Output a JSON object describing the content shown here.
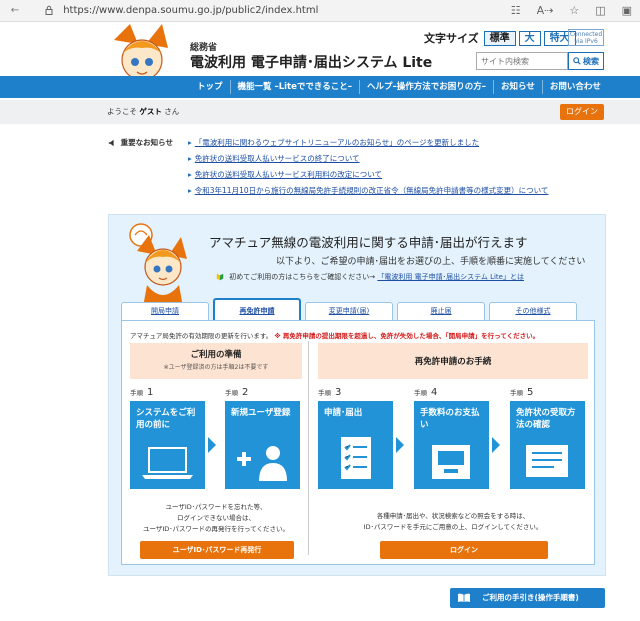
{
  "browser": {
    "url": "https://www.denpa.soumu.go.jp/public2/index.html",
    "icons": [
      "back-icon",
      "lock-icon",
      "translate-icon",
      "read-aloud-icon",
      "favorite-icon",
      "split-icon",
      "collections-icon"
    ]
  },
  "header": {
    "ministry": "総務省",
    "title": "電波利用 電子申請･届出システム Lite",
    "font_size_label": "文字サイズ",
    "font_sizes": [
      "標準",
      "大",
      "特大"
    ],
    "ipv6_badge": "Connected via IPv6",
    "search_placeholder": "サイト内検索",
    "search_button": "検索"
  },
  "nav": {
    "items": [
      "トップ",
      "機能一覧 –Liteでできること–",
      "ヘルプ–操作方法でお困りの方–",
      "お知らせ",
      "お問い合わせ"
    ]
  },
  "welcome": {
    "prefix": "ようこそ",
    "user": "ゲスト",
    "suffix": "さん",
    "login": "ログイン"
  },
  "notices": {
    "heading": "重要なお知らせ",
    "items": [
      "「電波利用に関わるウェブサイトリニューアルのお知らせ」のページを更新しました",
      "免許状の送料受取人払いサービスの終了について",
      "免許状の送料受取人払いサービス利用料の改定について",
      "令和3年11月10日から施行の無線局免許手続規則の改正省令（無線局免許申請書等の様式変更）について"
    ]
  },
  "hero": {
    "title": "アマチュア無線の電波利用に関する申請･届出が行えます",
    "subtitle": "以下より、ご希望の申請･届出をお選びの上、手順を順番に実施してください",
    "first_time": "初めてご利用の方はこちらをご確認ください→",
    "first_time_link": "「電波利用 電子申請･届出システム Lite」とは"
  },
  "tabs": {
    "items": [
      "開局申請",
      "再免許申請",
      "変更申請(届)",
      "廃止届",
      "その他様式"
    ],
    "active_index": 1
  },
  "content": {
    "intro": "アマチュア局免許の有効期限の更新を行います。",
    "warn": "※ 再免許申請の提出期限を超過し、免許が失効した場合、「開局申請」を行ってください。",
    "prep_title": "ご利用の準備",
    "prep_sub": "※ユーザ登録済の方は手順2は不要です",
    "renew_title": "再免許申請のお手続",
    "step_prefix": "手順",
    "steps": [
      {
        "num": "1",
        "title": "システムをご利用の前に",
        "icon": "laptop-icon"
      },
      {
        "num": "2",
        "title": "新規ユーザ登録",
        "icon": "user-add-icon"
      },
      {
        "num": "3",
        "title": "申請･届出",
        "icon": "form-checklist-icon"
      },
      {
        "num": "4",
        "title": "手数料のお支払い",
        "icon": "atm-payment-icon"
      },
      {
        "num": "5",
        "title": "免許状の受取方法の確認",
        "icon": "license-document-icon"
      }
    ],
    "note_left_1": "ユーザID･パスワードを忘れた等、",
    "note_left_2": "ログインできない場合は、",
    "note_left_3": "ユーザID･パスワードの再発行を行ってください。",
    "note_right_1": "各種申請･届出や、状況検索などの照会をする時は、",
    "note_right_2": "ID･パスワードを手元にご用意の上、ログインしてください。",
    "btn_reissue": "ユーザID･パスワード再発行",
    "btn_login": "ログイン"
  },
  "guide": {
    "label": "ご利用の手引き(操作手順書)"
  },
  "colors": {
    "nav_blue": "#1e7fcb",
    "step_blue": "#2193d6",
    "orange": "#e8730c",
    "panel_bg": "#e3f2fc",
    "warn_red": "#d21a1a"
  }
}
